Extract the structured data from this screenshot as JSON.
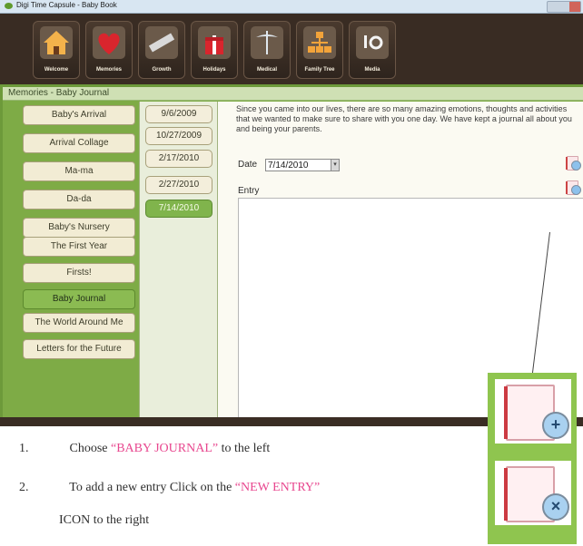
{
  "window": {
    "title": "Digi Time Capsule - Baby Book"
  },
  "toolbar": {
    "items": [
      {
        "label": "Welcome",
        "icon": "house-icon"
      },
      {
        "label": "Memories",
        "icon": "heart-icon"
      },
      {
        "label": "Growth",
        "icon": "ruler-icon"
      },
      {
        "label": "Holidays",
        "icon": "gift-icon"
      },
      {
        "label": "Medical",
        "icon": "caduceus-icon"
      },
      {
        "label": "Family Tree",
        "icon": "family-tree-icon"
      },
      {
        "label": "Media",
        "icon": "camera-icon"
      }
    ]
  },
  "panel": {
    "title": "Memories - Baby Journal"
  },
  "nav": {
    "items": [
      {
        "label": "Baby's Arrival"
      },
      {
        "label": "Arrival Collage"
      },
      {
        "label": "Ma-ma"
      },
      {
        "label": "Da-da"
      },
      {
        "label": "Baby's Nursery"
      },
      {
        "label": "The First Year"
      },
      {
        "label": "Firsts!"
      },
      {
        "label": "Baby Journal"
      },
      {
        "label": "The World Around Me"
      },
      {
        "label": "Letters for the Future"
      }
    ],
    "active_index": 7
  },
  "dates": {
    "items": [
      "9/6/2009",
      "10/27/2009",
      "2/17/2010",
      "2/27/2010",
      "7/14/2010"
    ],
    "active_index": 4
  },
  "content": {
    "intro": "Since you came into our lives, there are so many amazing emotions, thoughts and activities that we wanted to make sure to share with you one day.  We have kept a journal all about you and being your parents.",
    "date_label": "Date",
    "date_value": "7/14/2010",
    "entry_label": "Entry"
  },
  "instructions": {
    "step1_num": "1.",
    "step1_a": "Choose ",
    "step1_hl": "“BABY JOURNAL”",
    "step1_b": " to the left",
    "step2_num": "2.",
    "step2_a": "To add a new entry Click on the ",
    "step2_hl": "“NEW ENTRY”",
    "step2_c": "ICON to the right"
  },
  "colors": {
    "accent_green": "#7eab46",
    "toolbar_brown": "#392c23",
    "highlight_pink": "#e8478f"
  }
}
